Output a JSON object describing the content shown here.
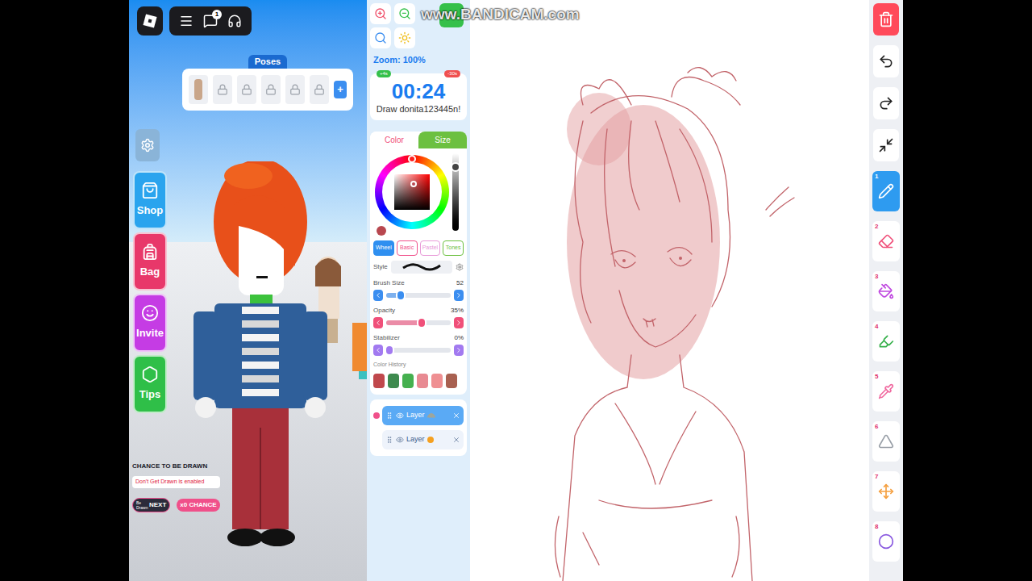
{
  "watermark": "www.BANDICAM.com",
  "top_bar": {
    "badge": "1"
  },
  "poses": {
    "title": "Poses",
    "add": "+",
    "slots": [
      {
        "locked": false
      },
      {
        "locked": true
      },
      {
        "locked": true
      },
      {
        "locked": true
      },
      {
        "locked": true
      },
      {
        "locked": true
      }
    ]
  },
  "side_buttons": [
    {
      "label": "Shop",
      "kind": "shop",
      "color": "#2aa4ee"
    },
    {
      "label": "Bag",
      "kind": "bag",
      "color": "#e8386a"
    },
    {
      "label": "Invite",
      "kind": "invite",
      "color": "#c53ce4"
    },
    {
      "label": "Tips",
      "kind": "tips",
      "color": "#2fbf48"
    }
  ],
  "chance": {
    "title": "CHANCE TO BE DRAWN",
    "notice": "Don't Get Drawn is enabled",
    "next_small": "Be Drawn",
    "next": "NEXT",
    "multiplier": "x0 CHANCE"
  },
  "zoom_buttons": [
    {
      "kind": "zoom-in",
      "color": "#f0506a"
    },
    {
      "kind": "zoom-out",
      "color": "#35c04a"
    },
    {
      "kind": "search",
      "color": "#3b8ef0"
    },
    {
      "kind": "fit",
      "color": "#f0c020"
    }
  ],
  "zoom": {
    "label": "Zoom: 100%"
  },
  "timer": {
    "time": "00:24",
    "plus": "+4s",
    "minus": "-30s",
    "prompt": "Draw donita123445n!"
  },
  "panel_tabs": [
    {
      "label": "Color",
      "selected": true
    },
    {
      "label": "Size",
      "selected": false
    }
  ],
  "color": {
    "current": "#b8474f",
    "hue": "#ff0000",
    "hue_level": 0.0,
    "saturation": 0.55,
    "value": 0.72,
    "brightness_level": 0.82
  },
  "palette_tabs": [
    {
      "label": "Wheel",
      "selected": true,
      "color": "#2f8ff0"
    },
    {
      "label": "Basic",
      "selected": false,
      "color": "#f0508a"
    },
    {
      "label": "Pastel",
      "selected": false,
      "color": "#e89ad8"
    },
    {
      "label": "Tones",
      "selected": false,
      "color": "#6cc040"
    }
  ],
  "style_label": "Style",
  "sliders": [
    {
      "label": "Brush Size",
      "reading": "52",
      "level": 0.22,
      "color": "#3b8ef0"
    },
    {
      "label": "Opacity",
      "reading": "35%",
      "level": 0.55,
      "color": "#f0507a"
    },
    {
      "label": "Stabilizer",
      "reading": "0%",
      "level": 0.05,
      "color": "#a27af0"
    }
  ],
  "color_history": {
    "title": "Color History",
    "swatches": [
      {
        "color": "#c0484c"
      },
      {
        "color": "#3e8a4e"
      },
      {
        "color": "#45b04f"
      },
      {
        "color": "#e88a92"
      },
      {
        "color": "#ef8f92"
      },
      {
        "color": "#a86050"
      }
    ]
  },
  "layers": [
    {
      "label": "Layer",
      "selected": true,
      "kind": "rainbow"
    },
    {
      "label": "Layer",
      "selected": false,
      "kind": "dot"
    }
  ],
  "actions": [
    {
      "kind": "trash",
      "color": "#ff4a5a"
    },
    {
      "kind": "undo",
      "color": "#ffffff"
    },
    {
      "kind": "redo",
      "color": "#ffffff"
    },
    {
      "kind": "collapse",
      "color": "#ffffff"
    }
  ],
  "tools": [
    {
      "number": "1",
      "kind": "pen",
      "selected": true,
      "color": "#ffffff"
    },
    {
      "number": "2",
      "kind": "eraser",
      "selected": false,
      "color": "#f0507a"
    },
    {
      "number": "3",
      "kind": "fill",
      "selected": false,
      "color": "#c04ae0"
    },
    {
      "number": "4",
      "kind": "highlighter",
      "selected": false,
      "color": "#35b04a"
    },
    {
      "number": "5",
      "kind": "picker",
      "selected": false,
      "color": "#f06aa0"
    },
    {
      "number": "6",
      "kind": "symmetry",
      "selected": false,
      "color": "#9aa0a8"
    },
    {
      "number": "7",
      "kind": "move",
      "selected": false,
      "color": "#f5a040"
    },
    {
      "number": "8",
      "kind": "shape",
      "selected": false,
      "color": "#8a5ae0"
    }
  ]
}
